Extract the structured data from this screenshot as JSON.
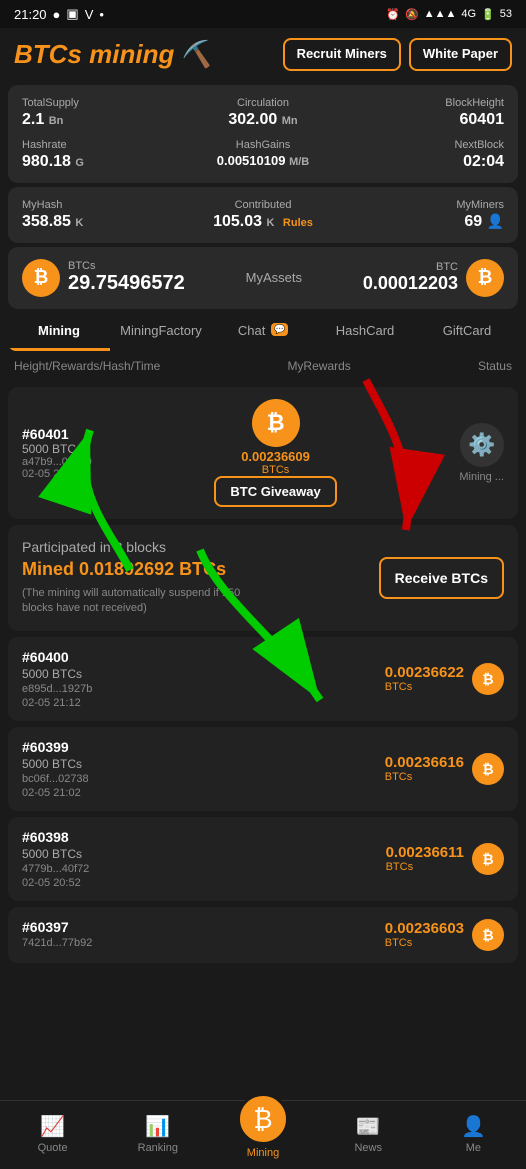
{
  "statusBar": {
    "time": "21:20",
    "icons": [
      "whatsapp",
      "message",
      "vivaldi",
      "dot"
    ],
    "rightIcons": [
      "alarm",
      "bell-off",
      "signal",
      "battery"
    ],
    "battery": "53",
    "network": "4G"
  },
  "header": {
    "logoText": "BTCs mining",
    "recruitBtn": "Recruit Miners",
    "whitePaperBtn": "White Paper"
  },
  "stats": {
    "totalSupplyLabel": "TotalSupply",
    "totalSupplyValue": "2.1",
    "totalSupplyUnit": "Bn",
    "circulationLabel": "Circulation",
    "circulationValue": "302.00",
    "circulationUnit": "Mn",
    "blockHeightLabel": "BlockHeight",
    "blockHeightValue": "60401",
    "hashrateLabel": "Hashrate",
    "hashrateValue": "980.18",
    "hashrateUnit": "G",
    "hashGainsLabel": "HashGains",
    "hashGainsValue": "0.00510109",
    "hashGainsUnit": "M/B",
    "nextBlockLabel": "NextBlock",
    "nextBlockValue": "02:04"
  },
  "myStats": {
    "myHashLabel": "MyHash",
    "myHashValue": "358.85",
    "myHashUnit": "K",
    "contributedLabel": "Contributed",
    "contributedValue": "105.03",
    "contributedUnit": "K",
    "contributedLink": "Rules",
    "myMinersLabel": "MyMiners",
    "myMinersValue": "69"
  },
  "assets": {
    "btcsLabel": "BTCs",
    "btcsValue": "29.75496572",
    "myAssetsLabel": "MyAssets",
    "btcLabel": "BTC",
    "btcValue": "0.00012203"
  },
  "tabs": [
    {
      "id": "mining",
      "label": "Mining",
      "active": true
    },
    {
      "id": "miningfactory",
      "label": "MiningFactory",
      "active": false
    },
    {
      "id": "chat",
      "label": "Chat",
      "badge": "💬",
      "active": false
    },
    {
      "id": "hashcard",
      "label": "HashCard",
      "active": false
    },
    {
      "id": "giftcard",
      "label": "GiftCard",
      "active": false
    }
  ],
  "tableHeaders": {
    "col1": "Height/Rewards/Hash/Time",
    "col2": "MyRewards",
    "col3": "Status"
  },
  "miningRows": [
    {
      "id": "#60401",
      "btcs": "5000 BTCs",
      "hash": "a47b9...0edc0",
      "time": "02-05 21:22",
      "giveawayAmount": "0.00236609",
      "giveawayUnit": "BTCs",
      "giveawayLabel": "BTC Giveaway",
      "status": "Mining ..."
    }
  ],
  "participated": {
    "title": "Participated in 8 blocks",
    "amount": "Mined 0.01892692 BTCs",
    "note": "(The mining will automatically suspend if 150 blocks have not received)",
    "receiveBtn": "Receive BTCs"
  },
  "simpleRows": [
    {
      "id": "#60400",
      "btcs": "5000 BTCs",
      "hash": "e895d...1927b",
      "time": "02-05 21:12",
      "amount": "0.00236622",
      "unit": "BTCs"
    },
    {
      "id": "#60399",
      "btcs": "5000 BTCs",
      "hash": "bc06f...02738",
      "time": "02-05 21:02",
      "amount": "0.00236616",
      "unit": "BTCs"
    },
    {
      "id": "#60398",
      "btcs": "5000 BTCs",
      "hash": "4779b...40f72",
      "time": "02-05 20:52",
      "amount": "0.00236611",
      "unit": "BTCs"
    },
    {
      "id": "#60397",
      "btcs": "",
      "hash": "7421d...77b92",
      "time": "",
      "amount": "0.00236603",
      "unit": "BTCs"
    }
  ],
  "bottomNav": [
    {
      "id": "quote",
      "label": "Quote",
      "icon": "📈",
      "active": false
    },
    {
      "id": "ranking",
      "label": "Ranking",
      "icon": "📊",
      "active": false
    },
    {
      "id": "mining",
      "label": "Mining",
      "icon": "₿",
      "active": true,
      "center": true
    },
    {
      "id": "news",
      "label": "News",
      "icon": "📰",
      "active": false
    },
    {
      "id": "me",
      "label": "Me",
      "icon": "👤",
      "active": false
    }
  ]
}
